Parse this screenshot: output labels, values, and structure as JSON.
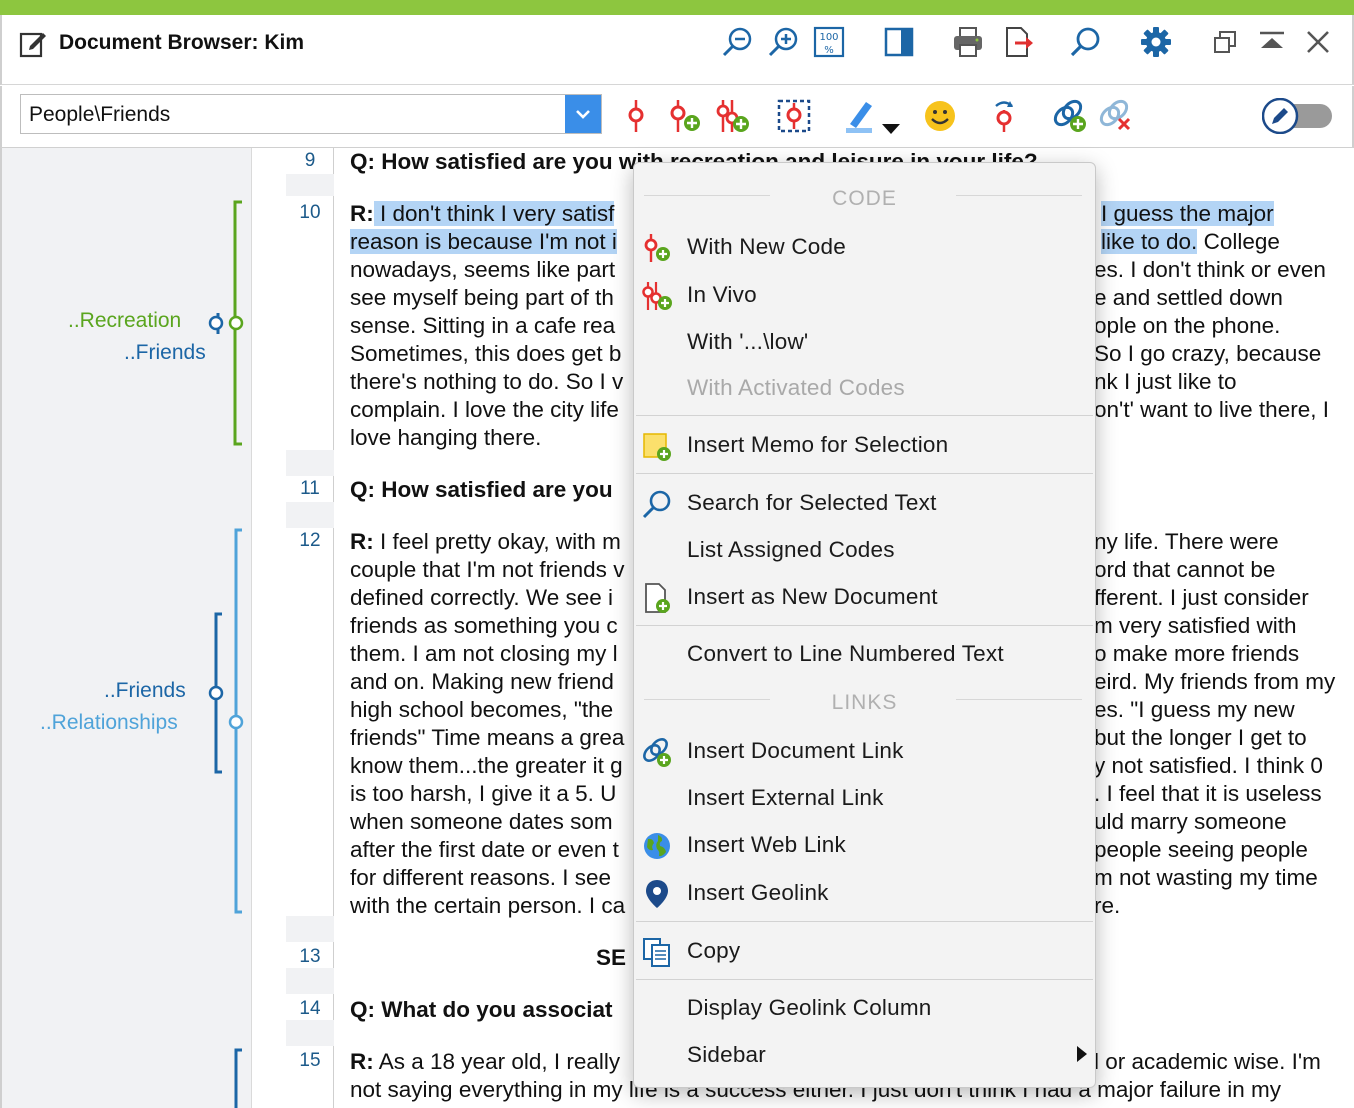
{
  "window": {
    "title": "Document Browser: Kim",
    "accent_color": "#8dc63f"
  },
  "title_toolbar": {
    "icons": [
      "zoom-out-icon",
      "zoom-in-icon",
      "zoom-100-icon",
      "panel-toggle-icon",
      "print-icon",
      "export-icon",
      "search-icon",
      "settings-icon",
      "restore-window-icon",
      "collapse-window-icon",
      "close-icon"
    ],
    "zoom_100_label": "100"
  },
  "toolbar": {
    "code_selector_value": "People\\Friends",
    "icons": [
      "code-selection-icon",
      "code-new-icon",
      "code-in-vivo-icon",
      "code-with-activated-icon",
      "highlight-pen-icon",
      "emoticode-icon",
      "undo-coding-icon",
      "insert-link-icon",
      "remove-link-icon",
      "edit-mode-toggle-icon"
    ]
  },
  "code_strip": {
    "labels": [
      {
        "text": "..Recreation",
        "color": "#5aa51e"
      },
      {
        "text": "..Friends",
        "color": "#1c66a6"
      },
      {
        "text": "..Friends",
        "color": "#1c66a6"
      },
      {
        "text": "..Relationships",
        "color": "#4fa3d9"
      }
    ]
  },
  "document": {
    "line_numbers": [
      "9",
      "10",
      "11",
      "12",
      "13",
      "14",
      "15"
    ],
    "paragraphs": {
      "p9": "Q: How satisfied are you with recreation and leisure in your life?",
      "p10_label": "R:",
      "p10_lines": [
        " I don't think I very satisf",
        "reason is because I'm not i",
        "nowadays, seems like part",
        "see myself being part of th",
        "sense. Sitting in a cafe rea",
        "Sometimes, this does get b",
        "there's nothing to do. So I v",
        "complain. I love the city life",
        "love hanging there."
      ],
      "p10_right": [
        "I guess the major",
        "like to do.",
        "es. I don't think or even",
        "e and settled down",
        "ople on the phone.",
        "So I go crazy, because",
        "nk I just like to",
        "on't' want to live there, I"
      ],
      "p10_right_tail": " College",
      "p11": "Q: How satisfied are you",
      "p12_label": "R:",
      "p12_lines": [
        " I feel pretty okay, with m",
        "couple that I'm not friends v",
        "defined correctly. We see i",
        "friends as something you c",
        "them. I am not closing my l",
        "and on. Making new friend",
        "high school becomes, \"the",
        "friends\" Time means a grea",
        "know them...the greater it g",
        "is too harsh, I give it a 5. U",
        "when someone dates som",
        "after the first date or even t",
        "for different reasons. I see",
        "with the certain person. I ca"
      ],
      "p12_right": [
        "ny life. There were",
        "ord that cannot be",
        "fferent. I just consider",
        "m very satisfied with",
        "o make more friends",
        "eird. My friends from my",
        "es. \"I guess my new",
        "but the longer I get to",
        "y not satisfied. I think 0",
        ". I feel that it is useless",
        "uld marry someone",
        "people seeing people",
        "m not wasting my time",
        "re."
      ],
      "p13": "SE",
      "p14": "Q: What do you associat",
      "p15_label": "R:",
      "p15_line1": " As a 18 year old, I really",
      "p15_line1_right": "l or academic wise. I'm",
      "p15_line2": "not saying everything in my life is a success either. I just don't think I had a major failure in my"
    }
  },
  "context_menu": {
    "section_code": "CODE",
    "with_new_code": "With New Code",
    "in_vivo": "In Vivo",
    "with_code": "With '...\\low'",
    "with_activated_codes": "With Activated Codes",
    "insert_memo": "Insert Memo for Selection",
    "search_selected": "Search for Selected Text",
    "list_assigned": "List Assigned Codes",
    "insert_new_doc": "Insert as New Document",
    "convert_line_numbered": "Convert to Line Numbered Text",
    "section_links": "LINKS",
    "insert_doc_link": "Insert Document Link",
    "insert_external_link": "Insert External Link",
    "insert_web_link": "Insert Web Link",
    "insert_geolink": "Insert Geolink",
    "copy": "Copy",
    "display_geolink_column": "Display Geolink Column",
    "sidebar": "Sidebar"
  }
}
